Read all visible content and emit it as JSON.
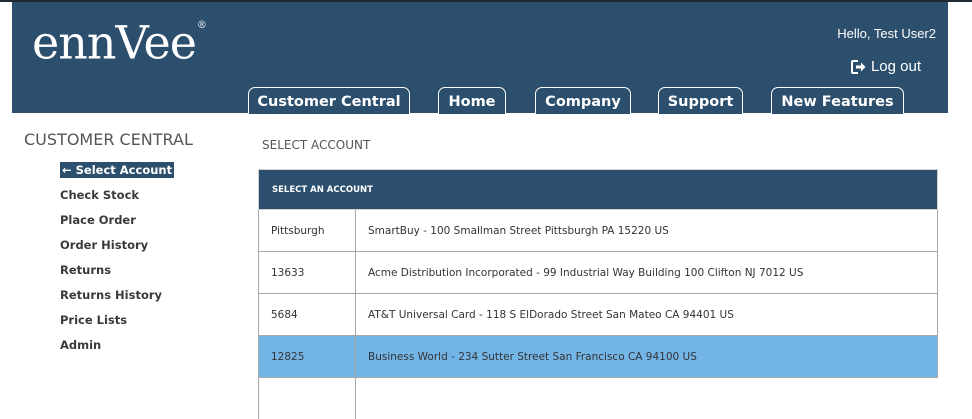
{
  "brand": {
    "logo_text": "ennVee",
    "logo_mark": "®"
  },
  "header": {
    "greeting": "Hello, Test User2",
    "logout_label": "Log out"
  },
  "nav_tabs": [
    {
      "label": "Customer Central"
    },
    {
      "label": "Home"
    },
    {
      "label": "Company"
    },
    {
      "label": "Support"
    },
    {
      "label": "New Features"
    }
  ],
  "sidebar": {
    "title": "CUSTOMER CENTRAL",
    "items": [
      {
        "label": "← Select Account",
        "active": true
      },
      {
        "label": "Check Stock"
      },
      {
        "label": "Place Order"
      },
      {
        "label": "Order History"
      },
      {
        "label": "Returns"
      },
      {
        "label": "Returns History"
      },
      {
        "label": "Price Lists"
      },
      {
        "label": "Admin"
      }
    ]
  },
  "main": {
    "title": "SELECT ACCOUNT",
    "table": {
      "header": "SELECT AN ACCOUNT",
      "rows": [
        {
          "id": "Pittsburgh",
          "details": "SmartBuy - 100 Smallman Street Pittsburgh PA 15220 US",
          "selected": false
        },
        {
          "id": "13633",
          "details": "Acme Distribution Incorporated - 99 Industrial Way Building 100 Clifton NJ 7012 US",
          "selected": false
        },
        {
          "id": "5684",
          "details": "AT&T Universal Card - 118 S ElDorado Street San Mateo CA 94401 US",
          "selected": false
        },
        {
          "id": "12825",
          "details": "Business World - 234 Sutter Street San Francisco CA 94100 US",
          "selected": true
        }
      ]
    }
  },
  "colors": {
    "header_bg": "#2c4f6d",
    "selected_row": "#74b5e8",
    "text_gray": "#555555"
  },
  "icons": {
    "logout": "sign-out-icon"
  }
}
